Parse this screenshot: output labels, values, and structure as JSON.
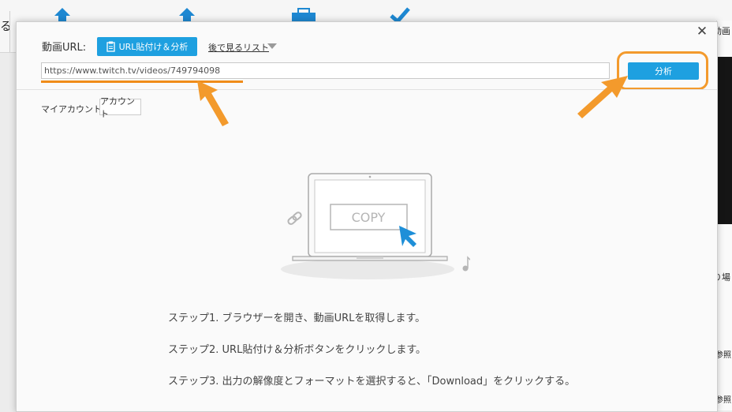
{
  "background": {
    "left_text": "る",
    "right_top_text": "動画",
    "right_mid_text": "り場",
    "right_ref_1": "参照",
    "right_ref_2": "参照"
  },
  "dialog": {
    "url_label": "動画URL:",
    "paste_button_label": "URL貼付け＆分析",
    "watch_later_label": "後で見るリスト",
    "url_input_value": "https://www.twitch.tv/videos/749794098",
    "analyze_button_label": "分析",
    "account_label": "マイアカウント",
    "account_button_label": "アカウント",
    "illustration_copy_text": "COPY",
    "steps": [
      "ステップ1. ブラウザーを開き、動画URLを取得します。",
      "ステップ2. URL貼付け＆分析ボタンをクリックします。",
      "ステップ3. 出力の解像度とフォーマットを選択すると、「Download」をクリックする。"
    ]
  },
  "colors": {
    "accent_blue": "#1ea0e0",
    "highlight_orange": "#f39a2c"
  },
  "icons": [
    "clipboard-icon",
    "dropdown-triangle-icon",
    "close-icon",
    "link-icon",
    "music-note-icon",
    "cursor-icon",
    "laptop-icon"
  ]
}
